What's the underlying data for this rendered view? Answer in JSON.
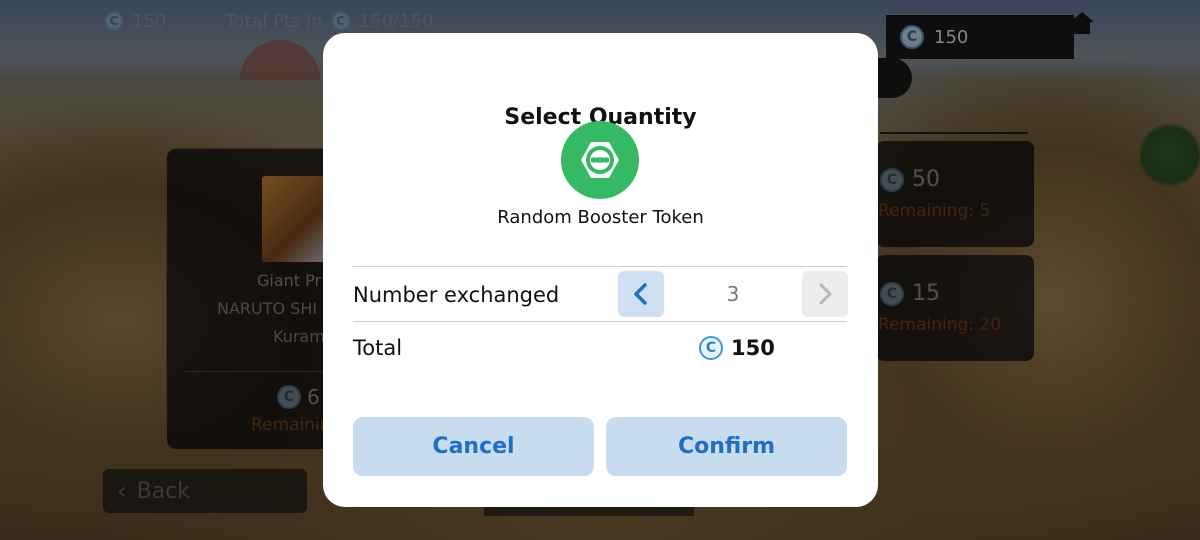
{
  "topbar": {
    "points": "150",
    "total_label": "Total Pts in",
    "total_value": "150/150"
  },
  "balance": {
    "value": "150"
  },
  "background": {
    "left_card": {
      "line1": "Giant Pr",
      "line2": "NARUTO SHI",
      "line3": "Kuram",
      "price": "6",
      "remaining": "Remainin"
    },
    "right_cards": [
      {
        "price": "50",
        "remaining": "Remaining: 5"
      },
      {
        "price": "15",
        "remaining": "Remaining: 20"
      }
    ],
    "back_label": "Back"
  },
  "dialog": {
    "title": "Select Quantity",
    "item_name": "Random Booster Token",
    "number_label": "Number exchanged",
    "quantity": "3",
    "total_label": "Total",
    "total_value": "150",
    "cancel_label": "Cancel",
    "confirm_label": "Confirm"
  },
  "colors": {
    "accent": "#1f6fc4",
    "item_icon": "#35b964",
    "remaining_text": "#7e4a1a",
    "button_bg": "#c8dcf0"
  },
  "icons": {
    "currency": "coin-c-icon",
    "item": "token-icon",
    "decrement": "chevron-left-icon",
    "increment": "chevron-right-icon",
    "home": "home-icon",
    "back": "chevron-left-icon"
  }
}
